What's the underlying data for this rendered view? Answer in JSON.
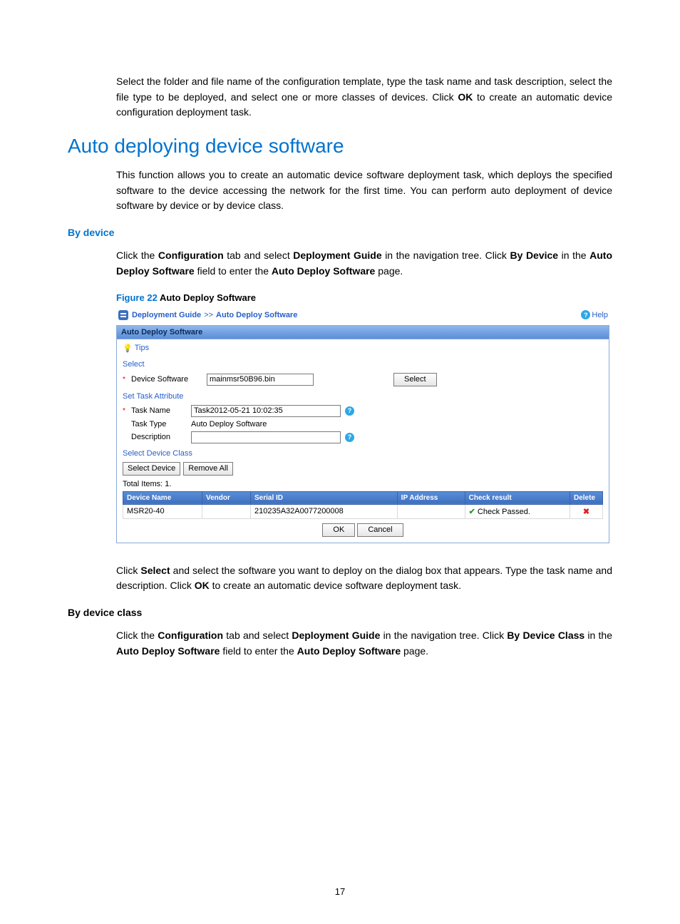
{
  "intro_para": "Select the folder and file name of the configuration template, type the task name and task description, select the file type to be deployed, and select one or more classes of devices. Click ",
  "intro_bold": "OK",
  "intro_tail": " to create an automatic device configuration deployment task.",
  "h1": "Auto deploying device software",
  "p1": "This function allows you to create an automatic device software deployment task, which deploys the specified software to the device accessing the network for the first time. You can perform auto deployment of device software by device or by device class.",
  "h3_bydev": "By device",
  "p2_a": "Click the ",
  "p2_b1": "Configuration",
  "p2_b": " tab and select ",
  "p2_b2": "Deployment Guide",
  "p2_c": " in the navigation tree. Click ",
  "p2_b3": "By Device",
  "p2_d": " in the ",
  "p2_b4": "Auto Deploy Software",
  "p2_e": " field to enter the ",
  "p2_b5": "Auto Deploy Software",
  "p2_f": " page.",
  "fig_no": "Figure 22 ",
  "fig_tt": "Auto Deploy Software",
  "ui": {
    "breadcrumb": {
      "a": "Deployment Guide",
      "sep": ">>",
      "b": "Auto Deploy Software"
    },
    "help": "Help",
    "panel_title": "Auto Deploy Software",
    "tips": "Tips",
    "select_label": "Select",
    "dev_sw_label": "Device Software",
    "dev_sw_val": "mainmsr50B96.bin",
    "select_btn": "Select",
    "set_task": "Set Task Attribute",
    "task_name_label": "Task Name",
    "task_name_val": "Task2012-05-21 10:02:35",
    "task_type_label": "Task Type",
    "task_type_val": "Auto Deploy Software",
    "desc_label": "Description",
    "desc_val": "",
    "sel_class": "Select Device Class",
    "sel_device_btn": "Select Device",
    "remove_all_btn": "Remove All",
    "total": "Total Items: 1.",
    "cols": {
      "dev": "Device Name",
      "vendor": "Vendor",
      "serial": "Serial ID",
      "ip": "IP Address",
      "check": "Check result",
      "del": "Delete"
    },
    "row": {
      "dev": "MSR20-40",
      "vendor": "",
      "serial": "210235A32A0077200008",
      "ip": "",
      "check": "Check Passed."
    },
    "ok": "OK",
    "cancel": "Cancel"
  },
  "p3_a": "Click ",
  "p3_b1": "Select",
  "p3_b": " and select the software you want to deploy on the dialog box that appears. Type the task name and description. Click ",
  "p3_b2": "OK",
  "p3_c": " to create an automatic device software deployment task.",
  "h3_byclass": "By device class",
  "p4_a": "Click the ",
  "p4_b1": "Configuration",
  "p4_b": " tab and select ",
  "p4_b2": "Deployment Guide",
  "p4_c": " in the navigation tree. Click ",
  "p4_b3": "By Device Class",
  "p4_d": " in the ",
  "p4_b4": "Auto Deploy Software",
  "p4_e": " field to enter the ",
  "p4_b5": "Auto Deploy Software",
  "p4_f": " page.",
  "page_num": "17"
}
